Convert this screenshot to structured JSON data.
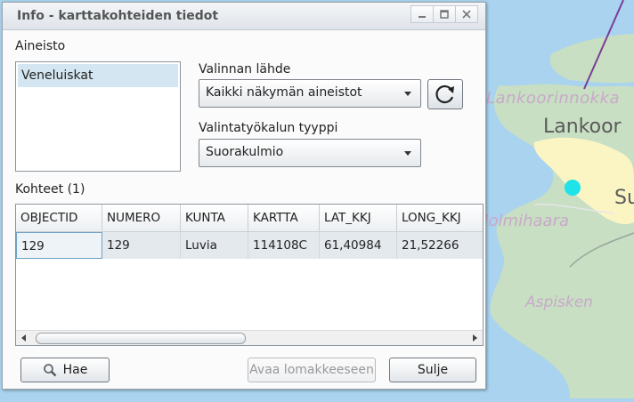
{
  "dialog": {
    "title": "Info - karttakohteiden tiedot",
    "window_buttons": [
      "minimize-icon",
      "maximize-icon",
      "close-icon"
    ]
  },
  "aineisto": {
    "label": "Aineisto",
    "items": [
      "Veneluiskat"
    ]
  },
  "source": {
    "label": "Valinnan lähde",
    "value": "Kaikki näkymän aineistot",
    "refresh_icon": "refresh-icon"
  },
  "tool": {
    "label": "Valintatyökalun tyyppi",
    "value": "Suorakulmio"
  },
  "results": {
    "label": "Kohteet",
    "count": "(1)",
    "columns": [
      "OBJECTID",
      "NUMERO",
      "KUNTA",
      "KARTTA",
      "LAT_KKJ",
      "LONG_KKJ"
    ],
    "rows": [
      [
        "129",
        "129",
        "Luvia",
        "114108C",
        "61,40984",
        "21,52266"
      ]
    ]
  },
  "buttons": {
    "search": "Hae",
    "search_icon": "magnifier-icon",
    "open_form": "Avaa lomakkeeseen",
    "close": "Sulje"
  },
  "map": {
    "labels": {
      "lankoorinnokka": "Lankoorinnokka",
      "lankoor": "Lankoor",
      "su": "Su",
      "holmihaara": "Holmihaara",
      "aspisken": "Aspisken"
    },
    "colors": {
      "water": "#a9d3ee",
      "land": "#c8dfc3",
      "urban": "#fbf5c4",
      "marker": "#1ee3e8",
      "boundary": "#7a3d97"
    }
  }
}
